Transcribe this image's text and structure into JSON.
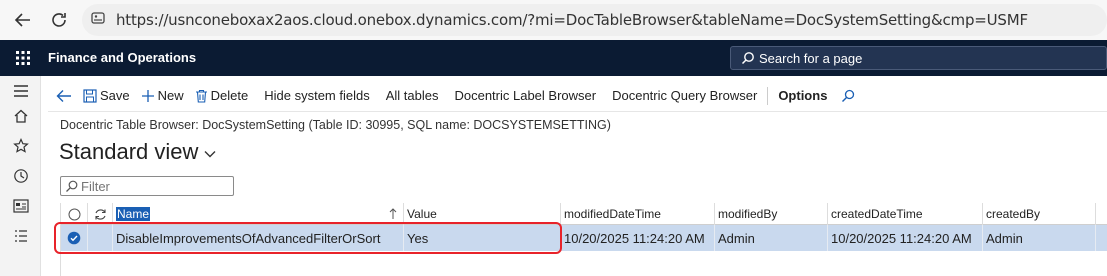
{
  "browser": {
    "url": "https://usnconeboxax2aos.cloud.onebox.dynamics.com/?mi=DocTableBrowser&tableName=DocSystemSetting&cmp=USMF"
  },
  "app": {
    "title": "Finance and Operations",
    "search_placeholder": "Search for a page"
  },
  "actions": {
    "save": "Save",
    "new": "New",
    "delete": "Delete",
    "hide_system_fields": "Hide system fields",
    "all_tables": "All tables",
    "label_browser": "Docentric Label Browser",
    "query_browser": "Docentric Query Browser",
    "options": "Options"
  },
  "page": {
    "breadcrumb": "Docentric Table Browser: DocSystemSetting (Table ID: 30995, SQL name: DOCSYSTEMSETTING)",
    "view_title": "Standard view",
    "filter_placeholder": "Filter"
  },
  "grid": {
    "columns": [
      "Name",
      "Value",
      "modifiedDateTime",
      "modifiedBy",
      "createdDateTime",
      "createdBy"
    ],
    "rows": [
      {
        "name": "DisableImprovementsOfAdvancedFilterOrSort",
        "value": "Yes",
        "modifiedDateTime": "10/20/2025 11:24:20 AM",
        "modifiedBy": "Admin",
        "createdDateTime": "10/20/2025 11:24:20 AM",
        "createdBy": "Admin"
      }
    ]
  },
  "colors": {
    "header_bg": "#0b1b33",
    "selected_row": "#c9d9ee",
    "highlight": "#e8232a",
    "accent": "#1a5fb4"
  }
}
